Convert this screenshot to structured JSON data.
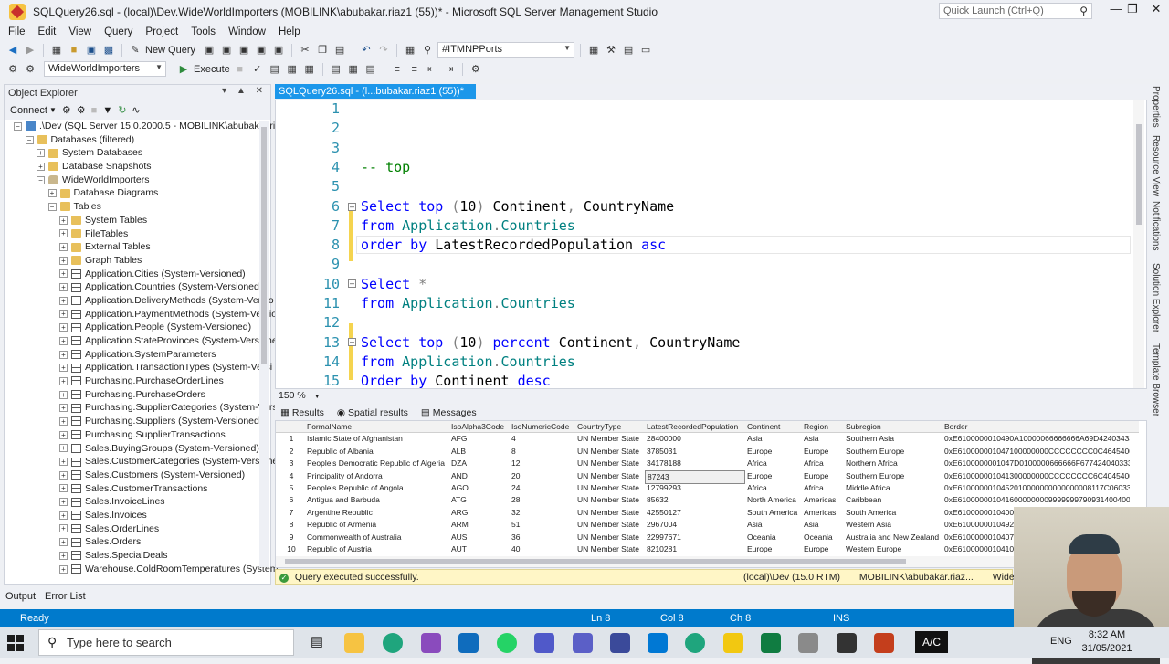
{
  "window": {
    "title": "SQLQuery26.sql - (local)\\Dev.WideWorldImporters (MOBILINK\\abubakar.riaz1 (55))* - Microsoft SQL Server Management Studio",
    "quick_launch_placeholder": "Quick Launch (Ctrl+Q)"
  },
  "menu": [
    "File",
    "Edit",
    "View",
    "Query",
    "Project",
    "Tools",
    "Window",
    "Help"
  ],
  "toolbar": {
    "new_query": "New Query",
    "server_combo": "#ITMNPPorts",
    "database_combo": "WideWorldImporters",
    "execute": "Execute"
  },
  "object_explorer": {
    "title": "Object Explorer",
    "connect": "Connect",
    "tree": [
      {
        "indent": 0,
        "exp": "-",
        "icon": "server",
        "label": ".\\Dev (SQL Server 15.0.2000.5 - MOBILINK\\abubakar.riaz"
      },
      {
        "indent": 1,
        "exp": "-",
        "icon": "folder",
        "label": "Databases (filtered)"
      },
      {
        "indent": 2,
        "exp": "+",
        "icon": "folder",
        "label": "System Databases"
      },
      {
        "indent": 2,
        "exp": "+",
        "icon": "folder",
        "label": "Database Snapshots"
      },
      {
        "indent": 2,
        "exp": "-",
        "icon": "db",
        "label": "WideWorldImporters"
      },
      {
        "indent": 3,
        "exp": "+",
        "icon": "folder",
        "label": "Database Diagrams"
      },
      {
        "indent": 3,
        "exp": "-",
        "icon": "folder",
        "label": "Tables"
      },
      {
        "indent": 4,
        "exp": "+",
        "icon": "folder",
        "label": "System Tables"
      },
      {
        "indent": 4,
        "exp": "+",
        "icon": "folder",
        "label": "FileTables"
      },
      {
        "indent": 4,
        "exp": "+",
        "icon": "folder",
        "label": "External Tables"
      },
      {
        "indent": 4,
        "exp": "+",
        "icon": "folder",
        "label": "Graph Tables"
      },
      {
        "indent": 4,
        "exp": "+",
        "icon": "table",
        "label": "Application.Cities (System-Versioned)"
      },
      {
        "indent": 4,
        "exp": "+",
        "icon": "table",
        "label": "Application.Countries (System-Versioned)"
      },
      {
        "indent": 4,
        "exp": "+",
        "icon": "table",
        "label": "Application.DeliveryMethods (System-Versio"
      },
      {
        "indent": 4,
        "exp": "+",
        "icon": "table",
        "label": "Application.PaymentMethods (System-Versio"
      },
      {
        "indent": 4,
        "exp": "+",
        "icon": "table",
        "label": "Application.People (System-Versioned)"
      },
      {
        "indent": 4,
        "exp": "+",
        "icon": "table",
        "label": "Application.StateProvinces (System-Versione"
      },
      {
        "indent": 4,
        "exp": "+",
        "icon": "table",
        "label": "Application.SystemParameters"
      },
      {
        "indent": 4,
        "exp": "+",
        "icon": "table",
        "label": "Application.TransactionTypes (System-Versi"
      },
      {
        "indent": 4,
        "exp": "+",
        "icon": "table",
        "label": "Purchasing.PurchaseOrderLines"
      },
      {
        "indent": 4,
        "exp": "+",
        "icon": "table",
        "label": "Purchasing.PurchaseOrders"
      },
      {
        "indent": 4,
        "exp": "+",
        "icon": "table",
        "label": "Purchasing.SupplierCategories (System-Vers"
      },
      {
        "indent": 4,
        "exp": "+",
        "icon": "table",
        "label": "Purchasing.Suppliers (System-Versioned)"
      },
      {
        "indent": 4,
        "exp": "+",
        "icon": "table",
        "label": "Purchasing.SupplierTransactions"
      },
      {
        "indent": 4,
        "exp": "+",
        "icon": "table",
        "label": "Sales.BuyingGroups (System-Versioned)"
      },
      {
        "indent": 4,
        "exp": "+",
        "icon": "table",
        "label": "Sales.CustomerCategories (System-Versione"
      },
      {
        "indent": 4,
        "exp": "+",
        "icon": "table",
        "label": "Sales.Customers (System-Versioned)"
      },
      {
        "indent": 4,
        "exp": "+",
        "icon": "table",
        "label": "Sales.CustomerTransactions"
      },
      {
        "indent": 4,
        "exp": "+",
        "icon": "table",
        "label": "Sales.InvoiceLines"
      },
      {
        "indent": 4,
        "exp": "+",
        "icon": "table",
        "label": "Sales.Invoices"
      },
      {
        "indent": 4,
        "exp": "+",
        "icon": "table",
        "label": "Sales.OrderLines"
      },
      {
        "indent": 4,
        "exp": "+",
        "icon": "table",
        "label": "Sales.Orders"
      },
      {
        "indent": 4,
        "exp": "+",
        "icon": "table",
        "label": "Sales.SpecialDeals"
      },
      {
        "indent": 4,
        "exp": "+",
        "icon": "table",
        "label": "Warehouse.ColdRoomTemperatures (System"
      }
    ]
  },
  "editor": {
    "tab_title": "SQLQuery26.sql - (l...bubakar.riaz1 (55))*",
    "zoom": "150 %",
    "lines": [
      {
        "n": "1",
        "tokens": []
      },
      {
        "n": "2",
        "tokens": []
      },
      {
        "n": "3",
        "tokens": []
      },
      {
        "n": "4",
        "tokens": [
          [
            "cm",
            "-- top"
          ]
        ]
      },
      {
        "n": "5",
        "tokens": []
      },
      {
        "n": "6",
        "tokens": [
          [
            "kw",
            "Select"
          ],
          [
            "",
            " "
          ],
          [
            "kw",
            "top"
          ],
          [
            "",
            " "
          ],
          [
            "gy",
            "("
          ],
          [
            "",
            "10"
          ],
          [
            "gy",
            ")"
          ],
          [
            "",
            " Continent"
          ],
          [
            "gy",
            ","
          ],
          [
            "",
            " CountryName"
          ]
        ]
      },
      {
        "n": "7",
        "tokens": [
          [
            "kw",
            "from"
          ],
          [
            "",
            " "
          ],
          [
            "tl",
            "Application"
          ],
          [
            "gy",
            "."
          ],
          [
            "tl",
            "Countries"
          ]
        ]
      },
      {
        "n": "8",
        "tokens": [
          [
            "kw",
            "order by"
          ],
          [
            "",
            " LatestRecordedPopulation "
          ],
          [
            "kw",
            "asc"
          ]
        ]
      },
      {
        "n": "9",
        "tokens": []
      },
      {
        "n": "10",
        "tokens": [
          [
            "kw",
            "Select"
          ],
          [
            "",
            " "
          ],
          [
            "gy",
            "*"
          ]
        ]
      },
      {
        "n": "11",
        "tokens": [
          [
            "kw",
            "from"
          ],
          [
            "",
            " "
          ],
          [
            "tl",
            "Application"
          ],
          [
            "gy",
            "."
          ],
          [
            "tl",
            "Countries"
          ]
        ]
      },
      {
        "n": "12",
        "tokens": []
      },
      {
        "n": "13",
        "tokens": [
          [
            "kw",
            "Select"
          ],
          [
            "",
            " "
          ],
          [
            "kw",
            "top"
          ],
          [
            "",
            " "
          ],
          [
            "gy",
            "("
          ],
          [
            "",
            "10"
          ],
          [
            "gy",
            ")"
          ],
          [
            "",
            " "
          ],
          [
            "kw",
            "percent"
          ],
          [
            "",
            " Continent"
          ],
          [
            "gy",
            ","
          ],
          [
            "",
            " CountryName"
          ]
        ]
      },
      {
        "n": "14",
        "tokens": [
          [
            "kw",
            "from"
          ],
          [
            "",
            " "
          ],
          [
            "tl",
            "Application"
          ],
          [
            "gy",
            "."
          ],
          [
            "tl",
            "Countries"
          ]
        ]
      },
      {
        "n": "15",
        "tokens": [
          [
            "kw",
            "Order by"
          ],
          [
            "",
            " Continent "
          ],
          [
            "kw",
            "desc"
          ]
        ]
      }
    ]
  },
  "results": {
    "tabs": [
      "Results",
      "Spatial results",
      "Messages"
    ],
    "columns": [
      "FormalName",
      "IsoAlpha3Code",
      "IsoNumericCode",
      "CountryType",
      "LatestRecordedPopulation",
      "Continent",
      "Region",
      "Subregion",
      "Border"
    ],
    "rows": [
      [
        "1",
        "Islamic State of Afghanistan",
        "AFG",
        "4",
        "UN Member State",
        "28400000",
        "Asia",
        "Asia",
        "Southern Asia",
        "0xE6100000010490A10000066666666A69D42403433"
      ],
      [
        "2",
        "Republic of Albania",
        "ALB",
        "8",
        "UN Member State",
        "3785031",
        "Europe",
        "Europe",
        "Southern Europe",
        "0xE610000001047100000000CCCCCCCC0C4645400000"
      ],
      [
        "3",
        "People's Democratic Republic of Algeria",
        "DZA",
        "12",
        "UN Member State",
        "34178188",
        "Africa",
        "Africa",
        "Northern Africa",
        "0xE6100000001047D0100000666666F677424040333"
      ],
      [
        "4",
        "Principality of Andorra",
        "AND",
        "20",
        "UN Member State",
        "87243",
        "Europe",
        "Europe",
        "Southern Europe",
        "0xE610000001041300000000CCCCCCCC6C4045400000"
      ],
      [
        "5",
        "People's Republic of Angola",
        "AGO",
        "24",
        "UN Member State",
        "12799293",
        "Africa",
        "Africa",
        "Middle Africa",
        "0xE6100000010452010000000000000008117C060333"
      ],
      [
        "6",
        "Antigua and Barbuda",
        "ATG",
        "28",
        "UN Member State",
        "85632",
        "North America",
        "Americas",
        "Caribbean",
        "0xE610000001041600000000999999979093140040000"
      ],
      [
        "7",
        "Argentine Republic",
        "ARG",
        "32",
        "UN Member State",
        "42550127",
        "South America",
        "Americas",
        "South America",
        "0xE6100000010400"
      ],
      [
        "8",
        "Republic of Armenia",
        "ARM",
        "51",
        "UN Member State",
        "2967004",
        "Asia",
        "Asia",
        "Western Asia",
        "0xE6100000010492"
      ],
      [
        "9",
        "Commonwealth of Australia",
        "AUS",
        "36",
        "UN Member State",
        "22997671",
        "Oceania",
        "Oceania",
        "Australia and New Zealand",
        "0xE6100000010407"
      ],
      [
        "10",
        "Republic of Austria",
        "AUT",
        "40",
        "UN Member State",
        "8210281",
        "Europe",
        "Europe",
        "Western Europe",
        "0xE6100000010410"
      ]
    ]
  },
  "query_status": {
    "message": "Query executed successfully.",
    "server": "(local)\\Dev (15.0 RTM)",
    "user": "MOBILINK\\abubakar.riaz...",
    "database": "WideWorldIm"
  },
  "bottom_tabs": [
    "Output",
    "Error List"
  ],
  "statusbar": {
    "ready": "Ready",
    "ln": "Ln 8",
    "col": "Col 8",
    "ch": "Ch 8",
    "mode": "INS"
  },
  "right_dock": [
    "Properties",
    "Resource View",
    "Notifications",
    "Solution Explorer",
    "Template Browser"
  ],
  "taskbar": {
    "search_placeholder": "Type here to search",
    "keyboard": "A/C",
    "language": "ENG",
    "time": "8:32 AM",
    "date": "31/05/2021"
  },
  "colors": {
    "accent": "#007acc",
    "tab_active": "#1c97ea",
    "keyword": "#0000ff",
    "comment": "#008000",
    "table_name": "#008080"
  }
}
